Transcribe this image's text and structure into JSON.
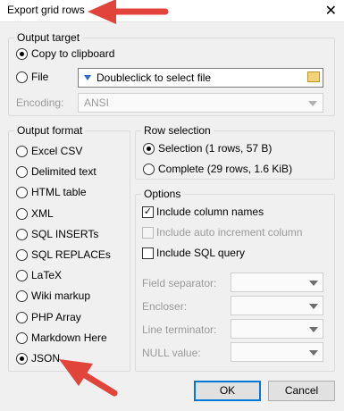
{
  "window": {
    "title": "Export grid rows",
    "close_glyph": "✕"
  },
  "output_target": {
    "legend": "Output target",
    "copy_label": "Copy to clipboard",
    "file_label": "File",
    "file_placeholder": "Doubleclick to select file",
    "encoding_label": "Encoding:",
    "encoding_value": "ANSI",
    "selected": "Copy to clipboard"
  },
  "output_format": {
    "legend": "Output format",
    "options": [
      "Excel CSV",
      "Delimited text",
      "HTML table",
      "XML",
      "SQL INSERTs",
      "SQL REPLACEs",
      "LaTeX",
      "Wiki markup",
      "PHP Array",
      "Markdown Here",
      "JSON"
    ],
    "selected": "JSON"
  },
  "row_selection": {
    "legend": "Row selection",
    "selection_label": "Selection (1 rows, 57 B)",
    "complete_label": "Complete (29 rows, 1.6 KiB)",
    "selected": "Selection (1 rows, 57 B)"
  },
  "options": {
    "legend": "Options",
    "include_column_names": {
      "label": "Include column names",
      "checked": true
    },
    "include_auto_increment": {
      "label": "Include auto increment column",
      "checked": false,
      "disabled": true
    },
    "include_sql_query": {
      "label": "Include SQL query",
      "checked": false
    },
    "field_separator_label": "Field separator:",
    "encloser_label": "Encloser:",
    "line_terminator_label": "Line terminator:",
    "null_value_label": "NULL value:"
  },
  "buttons": {
    "ok": "OK",
    "cancel": "Cancel"
  },
  "annotation_color": "#e0443b"
}
